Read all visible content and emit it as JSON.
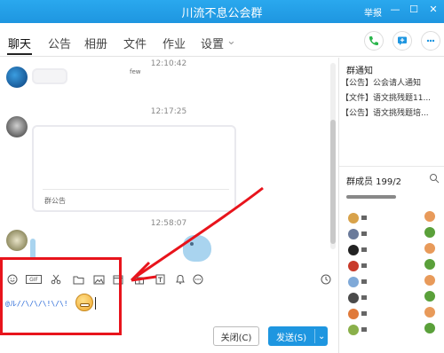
{
  "window": {
    "title": "川流不息公会群",
    "report_label": "举报",
    "minimize_glyph": "—",
    "maximize_glyph": "☐",
    "close_glyph": "✕"
  },
  "tabs": [
    {
      "label": "聊天",
      "active": true
    },
    {
      "label": "公告",
      "active": false
    },
    {
      "label": "相册",
      "active": false
    },
    {
      "label": "文件",
      "active": false
    },
    {
      "label": "作业",
      "active": false
    },
    {
      "label": "设置",
      "active": false
    }
  ],
  "tab_dropdown_glyph": "⌄",
  "header_icons": [
    "phone-icon",
    "screen-share-icon",
    "more-icon"
  ],
  "chat": {
    "messages": [
      {
        "time": "12:10:42",
        "preview_text": "few"
      },
      {
        "time": "12:17:25",
        "card_label": "群公告"
      },
      {
        "time": "12:58:07"
      }
    ]
  },
  "toolbar": {
    "icons": [
      "emoji-icon",
      "gif-icon",
      "scissors-icon",
      "folder-icon",
      "image-icon",
      "calendar-icon",
      "gift-icon",
      "document-icon",
      "bell-icon",
      "more-icon"
    ],
    "gif_label": "GIF",
    "history_icon": "clock-icon"
  },
  "input": {
    "draft_text": "@ル//\\/\\/\\!\\/\\!"
  },
  "actions": {
    "close_label": "关闭(C)",
    "send_label": "发送(S)",
    "send_dropdown": "⌄"
  },
  "right_panel": {
    "notice_title": "群通知",
    "notices": [
      "【公告】公会请人通知",
      "【文件】语文挑残题11...",
      "【公告】语文挑残题培..."
    ],
    "members_title": "群成员 199/2"
  },
  "colors": {
    "titlebar": "#1e96e0",
    "accent": "#1e96e0",
    "annotation_red": "#e8141c",
    "bubble_blue": "#a9d4ef"
  }
}
